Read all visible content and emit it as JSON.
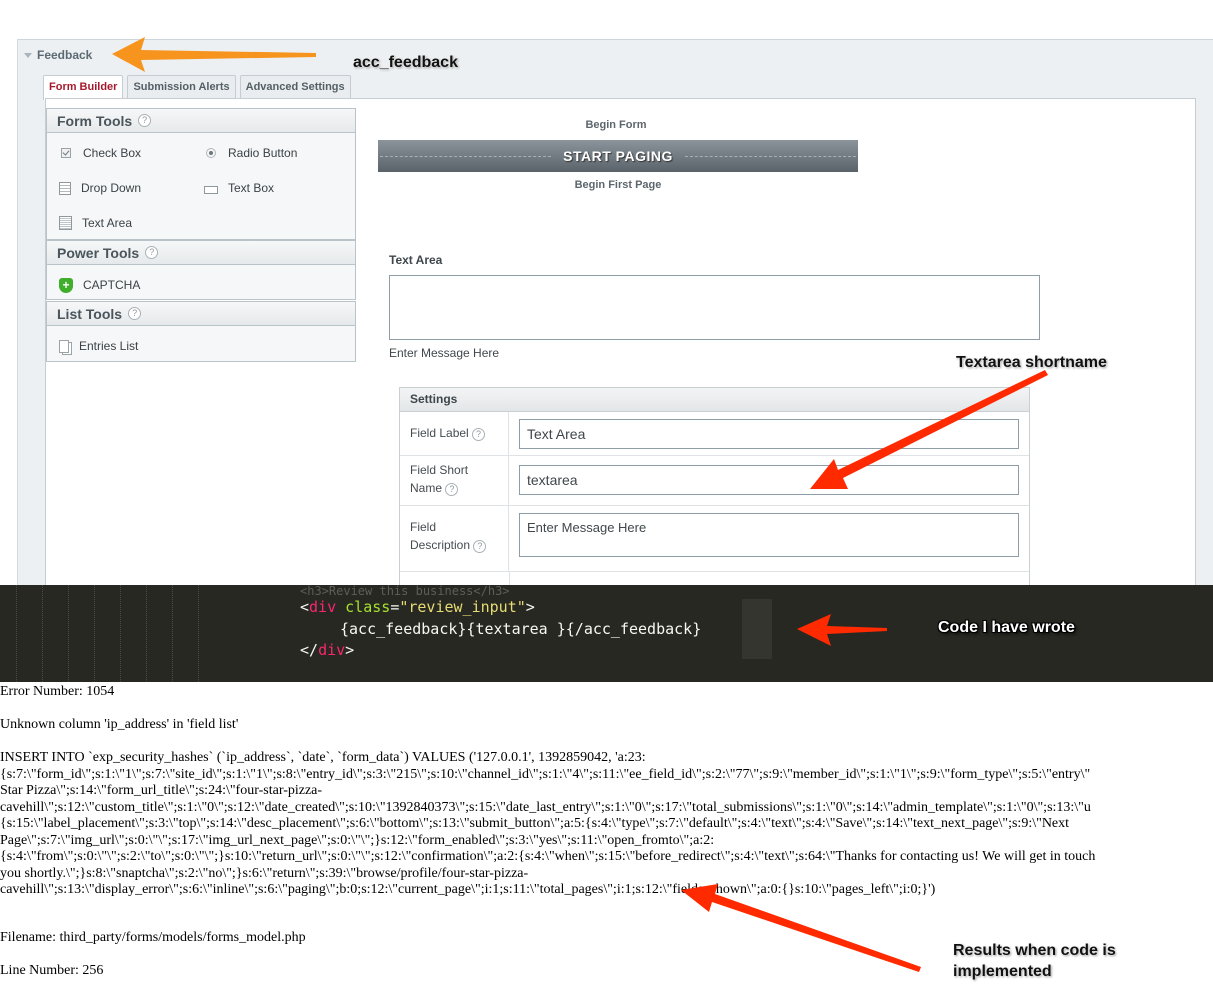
{
  "accordion": {
    "title": "Feedback"
  },
  "tabs": [
    {
      "label": "Form Builder",
      "active": true
    },
    {
      "label": "Submission Alerts",
      "active": false
    },
    {
      "label": "Advanced Settings",
      "active": false
    }
  ],
  "tool_panels": {
    "form_tools": {
      "title": "Form Tools",
      "help": "?",
      "items": [
        {
          "label": "Check Box",
          "icon": "checkbox-icon"
        },
        {
          "label": "Radio Button",
          "icon": "radio-icon"
        },
        {
          "label": "Drop Down",
          "icon": "dropdown-icon"
        },
        {
          "label": "Text Box",
          "icon": "textbox-icon"
        },
        {
          "label": "Text Area",
          "icon": "textarea-icon"
        }
      ]
    },
    "power_tools": {
      "title": "Power Tools",
      "help": "?",
      "items": [
        {
          "label": "CAPTCHA",
          "icon": "shield-plus-icon",
          "glyph": "+"
        }
      ]
    },
    "list_tools": {
      "title": "List Tools",
      "help": "?",
      "items": [
        {
          "label": "Entries List",
          "icon": "documents-icon"
        }
      ]
    }
  },
  "canvas": {
    "begin_form": "Begin Form",
    "paging_bar": "START PAGING",
    "begin_page": "Begin First Page",
    "field_label": "Text Area",
    "field_description": "Enter Message Here"
  },
  "settings": {
    "title": "Settings",
    "rows": [
      {
        "label": "Field Label",
        "value": "Text Area"
      },
      {
        "label_line1": "Field Short",
        "label_line2": "Name",
        "value": "textarea"
      },
      {
        "label_line1": "Field",
        "label_line2": "Description",
        "value": "Enter Message Here"
      }
    ]
  },
  "code": {
    "faded_line": "<h3>Review this business</h3>",
    "line1_open": "<",
    "line1_tag": "div",
    "line1_attr": " class",
    "line1_eq": "=",
    "line1_str": "\"review_input\"",
    "line1_close": ">",
    "line2": "{acc_feedback}{textarea }{/acc_feedback}",
    "line3_open": "</",
    "line3_tag": "div",
    "line3_close": ">"
  },
  "error": {
    "number": "Error Number: 1054",
    "message": "Unknown column 'ip_address' in 'field list'",
    "sql_lines": [
      "INSERT INTO `exp_security_hashes` (`ip_address`, `date`, `form_data`) VALUES ('127.0.0.1', 1392859042, 'a:23:",
      "{s:7:\\\"form_id\\\";s:1:\\\"1\\\";s:7:\\\"site_id\\\";s:1:\\\"1\\\";s:8:\\\"entry_id\\\";s:3:\\\"215\\\";s:10:\\\"channel_id\\\";s:1:\\\"4\\\";s:11:\\\"ee_field_id\\\";s:2:\\\"77\\\";s:9:\\\"member_id\\\";s:1:\\\"1\\\";s:9:\\\"form_type\\\";s:5:\\\"entry\\\"",
      "Star Pizza\\\";s:14:\\\"form_url_title\\\";s:24:\\\"four-star-pizza-",
      "cavehill\\\";s:12:\\\"custom_title\\\";s:1:\\\"0\\\";s:12:\\\"date_created\\\";s:10:\\\"1392840373\\\";s:15:\\\"date_last_entry\\\";s:1:\\\"0\\\";s:17:\\\"total_submissions\\\";s:1:\\\"0\\\";s:14:\\\"admin_template\\\";s:1:\\\"0\\\";s:13:\\\"u",
      "{s:15:\\\"label_placement\\\";s:3:\\\"top\\\";s:14:\\\"desc_placement\\\";s:6:\\\"bottom\\\";s:13:\\\"submit_button\\\";a:5:{s:4:\\\"type\\\";s:7:\\\"default\\\";s:4:\\\"text\\\";s:4:\\\"Save\\\";s:14:\\\"text_next_page\\\";s:9:\\\"Next",
      "Page\\\";s:7:\\\"img_url\\\";s:0:\\\"\\\";s:17:\\\"img_url_next_page\\\";s:0:\\\"\\\";}s:12:\\\"form_enabled\\\";s:3:\\\"yes\\\";s:11:\\\"open_fromto\\\";a:2:",
      "{s:4:\\\"from\\\";s:0:\\\"\\\";s:2:\\\"to\\\";s:0:\\\"\\\";}s:10:\\\"return_url\\\";s:0:\\\"\\\";s:12:\\\"confirmation\\\";a:2:{s:4:\\\"when\\\";s:15:\\\"before_redirect\\\";s:4:\\\"text\\\";s:64:\\\"Thanks for contacting us! We will get in touch",
      "you shortly.\\\";}s:8:\\\"snaptcha\\\";s:2:\\\"no\\\";}s:6:\\\"return\\\";s:39:\\\"browse/profile/four-star-pizza-",
      "cavehill\\\";s:13:\\\"display_error\\\";s:6:\\\"inline\\\";s:6:\\\"paging\\\";b:0;s:12:\\\"current_page\\\";i:1;s:11:\\\"total_pages\\\";i:1;s:12:\\\"fields_shown\\\";a:0:{}s:10:\\\"pages_left\\\";i:0;}')"
    ],
    "filename": "Filename: third_party/forms/models/forms_model.php",
    "line_number": "Line Number: 256"
  },
  "annotations": {
    "acc_feedback": "acc_feedback",
    "textarea_shortname": "Textarea shortname",
    "code_wrote": "Code I have wrote",
    "results_line1": "Results when code is",
    "results_line2": "implemented",
    "orange_arrow_color": "#f7941d",
    "red_arrow_color": "#ff2a00"
  }
}
